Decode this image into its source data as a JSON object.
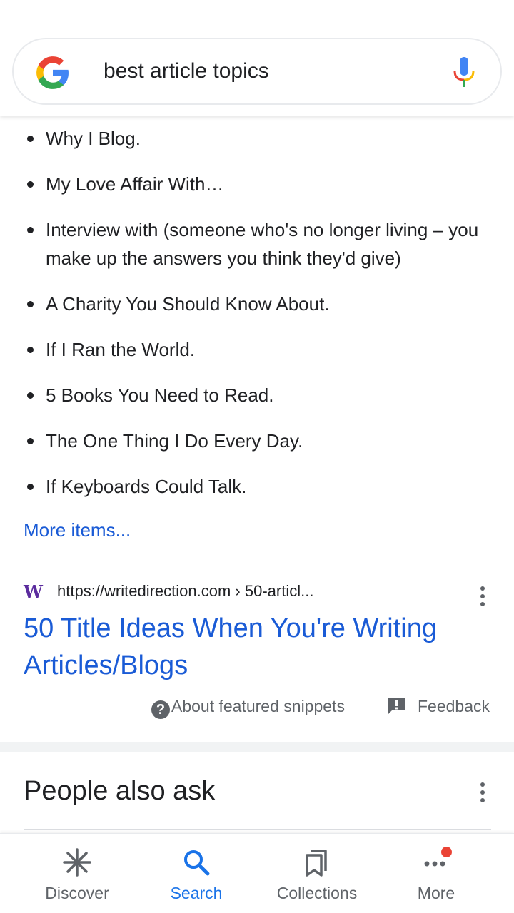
{
  "search": {
    "query": "best article topics",
    "logo_icon": "google-g-icon",
    "mic_icon": "microphone-icon"
  },
  "snippet": {
    "items": [
      "Why I Blog.",
      "My Love Affair With…",
      "Interview with (someone who's no longer living – you make up the answers you think they'd give)",
      "A Charity You Should Know About.",
      "If I Ran the World.",
      "5 Books You Need to Read.",
      "The One Thing I Do Every Day.",
      "If Keyboards Could Talk."
    ],
    "more_items_label": "More items...",
    "source_url": "https://writedirection.com › 50-articl...",
    "favicon_letter": "W",
    "result_title": "50 Title Ideas When You're Writing Articles/Blogs",
    "about_label": "About featured snippets",
    "feedback_label": "Feedback"
  },
  "people_also_ask": {
    "heading": "People also ask"
  },
  "bottom_nav": {
    "items": [
      {
        "label": "Discover",
        "icon": "asterisk-icon"
      },
      {
        "label": "Search",
        "icon": "search-icon",
        "active": true
      },
      {
        "label": "Collections",
        "icon": "bookmarks-icon"
      },
      {
        "label": "More",
        "icon": "more-dots-icon",
        "badge": true
      }
    ]
  },
  "colors": {
    "link": "#1a5bd6",
    "active_nav": "#1a73e8",
    "badge": "#ea4335",
    "text": "#202124",
    "secondary_text": "#5f6368"
  }
}
